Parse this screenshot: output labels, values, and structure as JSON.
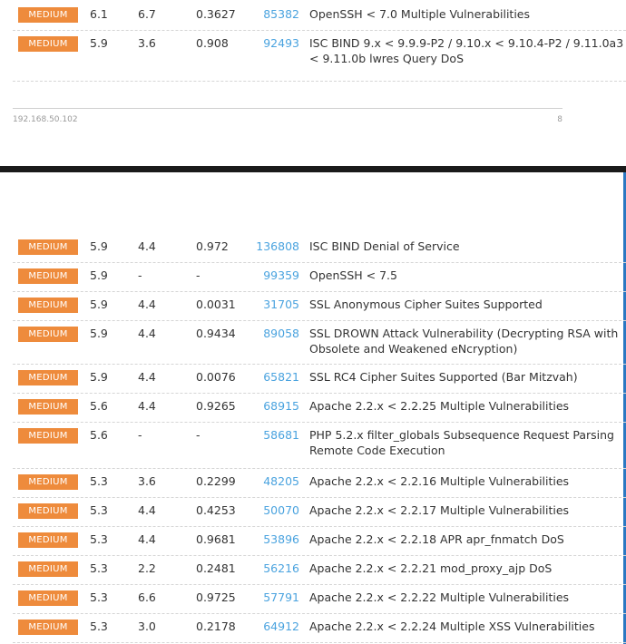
{
  "top_rows": [
    {
      "severity": "MEDIUM",
      "cvss": "6.1",
      "vpr": "6.7",
      "epss": "0.3627",
      "plugin_id": "85382",
      "name": "OpenSSH < 7.0 Multiple Vulnerabilities"
    },
    {
      "severity": "MEDIUM",
      "cvss": "5.9",
      "vpr": "3.6",
      "epss": "0.908",
      "plugin_id": "92493",
      "name": "ISC BIND 9.x < 9.9.9-P2 / 9.10.x < 9.10.4-P2 / 9.11.0a3 < 9.11.0b lwres Query DoS"
    }
  ],
  "footer": {
    "host": "192.168.50.102",
    "page_number": "8"
  },
  "bottom_rows": [
    {
      "severity": "MEDIUM",
      "cvss": "5.9",
      "vpr": "4.4",
      "epss": "0.972",
      "plugin_id": "136808",
      "name": "ISC BIND Denial of Service"
    },
    {
      "severity": "MEDIUM",
      "cvss": "5.9",
      "vpr": "-",
      "epss": "-",
      "plugin_id": "99359",
      "name": "OpenSSH < 7.5"
    },
    {
      "severity": "MEDIUM",
      "cvss": "5.9",
      "vpr": "4.4",
      "epss": "0.0031",
      "plugin_id": "31705",
      "name": "SSL Anonymous Cipher Suites Supported"
    },
    {
      "severity": "MEDIUM",
      "cvss": "5.9",
      "vpr": "4.4",
      "epss": "0.9434",
      "plugin_id": "89058",
      "name": "SSL DROWN Attack Vulnerability (Decrypting RSA with Obsolete and Weakened eNcryption)"
    },
    {
      "severity": "MEDIUM",
      "cvss": "5.9",
      "vpr": "4.4",
      "epss": "0.0076",
      "plugin_id": "65821",
      "name": "SSL RC4 Cipher Suites Supported (Bar Mitzvah)"
    },
    {
      "severity": "MEDIUM",
      "cvss": "5.6",
      "vpr": "4.4",
      "epss": "0.9265",
      "plugin_id": "68915",
      "name": "Apache 2.2.x < 2.2.25 Multiple Vulnerabilities"
    },
    {
      "severity": "MEDIUM",
      "cvss": "5.6",
      "vpr": "-",
      "epss": "-",
      "plugin_id": "58681",
      "name": "PHP 5.2.x filter_globals Subsequence Request Parsing Remote Code Execution"
    },
    {
      "severity": "MEDIUM",
      "cvss": "5.3",
      "vpr": "3.6",
      "epss": "0.2299",
      "plugin_id": "48205",
      "name": "Apache 2.2.x < 2.2.16 Multiple Vulnerabilities"
    },
    {
      "severity": "MEDIUM",
      "cvss": "5.3",
      "vpr": "4.4",
      "epss": "0.4253",
      "plugin_id": "50070",
      "name": "Apache 2.2.x < 2.2.17 Multiple Vulnerabilities"
    },
    {
      "severity": "MEDIUM",
      "cvss": "5.3",
      "vpr": "4.4",
      "epss": "0.9681",
      "plugin_id": "53896",
      "name": "Apache 2.2.x < 2.2.18 APR apr_fnmatch DoS"
    },
    {
      "severity": "MEDIUM",
      "cvss": "5.3",
      "vpr": "2.2",
      "epss": "0.2481",
      "plugin_id": "56216",
      "name": "Apache 2.2.x < 2.2.21 mod_proxy_ajp DoS"
    },
    {
      "severity": "MEDIUM",
      "cvss": "5.3",
      "vpr": "6.6",
      "epss": "0.9725",
      "plugin_id": "57791",
      "name": "Apache 2.2.x < 2.2.22 Multiple Vulnerabilities"
    },
    {
      "severity": "MEDIUM",
      "cvss": "5.3",
      "vpr": "3.0",
      "epss": "0.2178",
      "plugin_id": "64912",
      "name": "Apache 2.2.x < 2.2.24 Multiple XSS Vulnerabilities"
    }
  ]
}
